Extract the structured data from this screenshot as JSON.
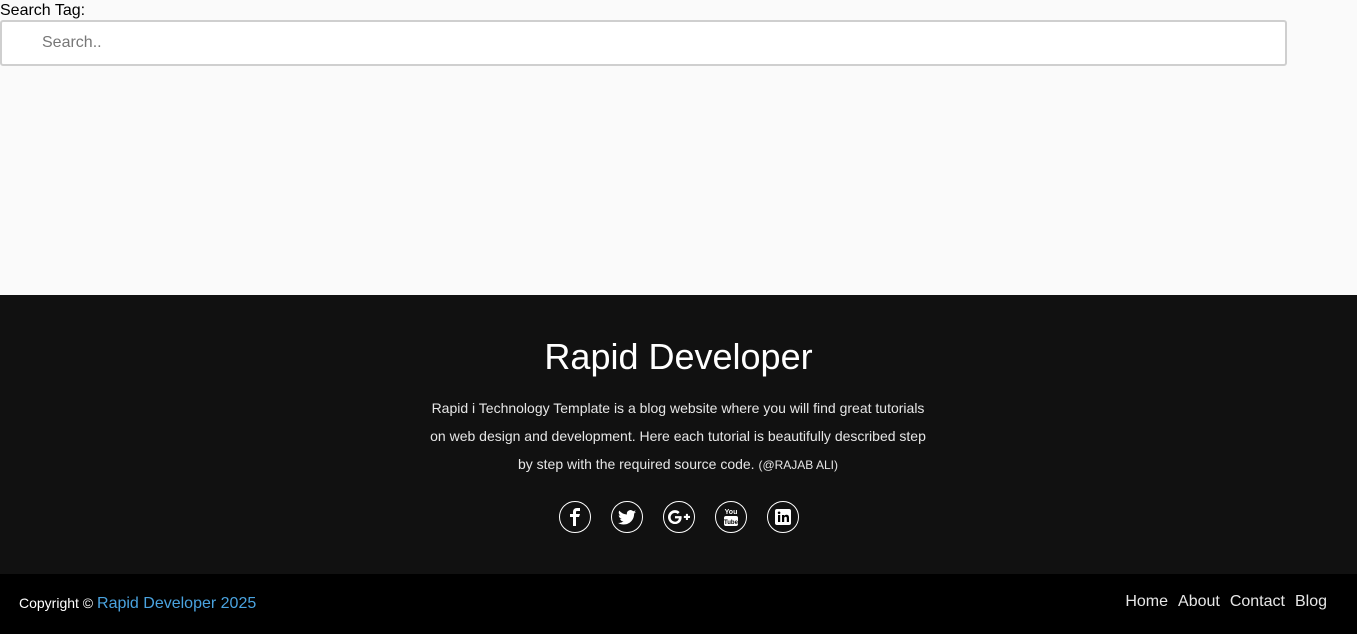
{
  "search": {
    "label": "Search Tag:",
    "placeholder": "Search..",
    "value": ""
  },
  "footer": {
    "title": "Rapid Developer",
    "description": "Rapid i Technology Template is a blog website where you will find great tutorials on web design and development. Here each tutorial is beautifully described step by step with the required source code.",
    "author": "(@RAJAB ALI)",
    "social": [
      {
        "name": "facebook-icon"
      },
      {
        "name": "twitter-icon"
      },
      {
        "name": "google-plus-icon"
      },
      {
        "name": "youtube-icon"
      },
      {
        "name": "linkedin-icon"
      }
    ]
  },
  "bottom": {
    "copyright_prefix": "Copyright ©",
    "brand": "Rapid Developer 2025",
    "nav": [
      "Home",
      "About",
      "Contact",
      "Blog"
    ]
  },
  "colors": {
    "footer_bg": "#111111",
    "bottom_bg": "#000000",
    "brand_link": "#4aa3df"
  }
}
